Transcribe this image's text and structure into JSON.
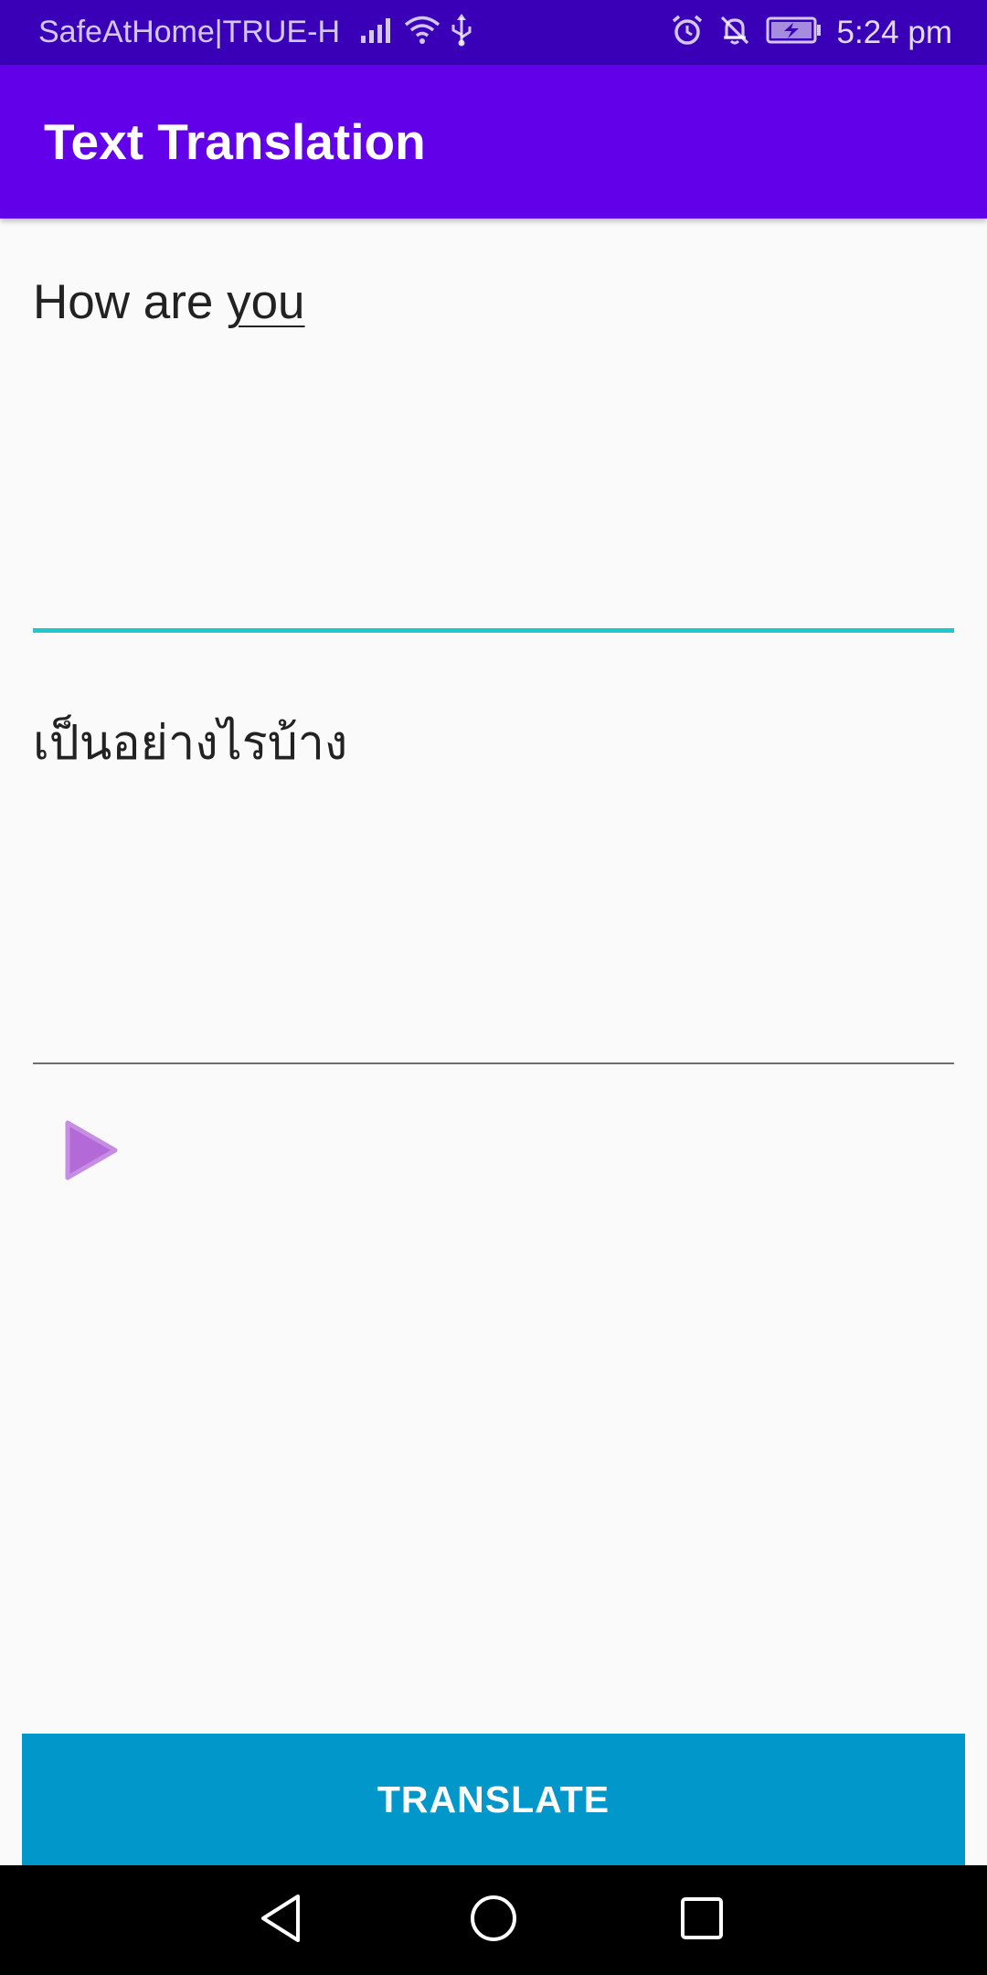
{
  "status_bar": {
    "carrier": "SafeAtHome|TRUE-H",
    "time": "5:24 pm",
    "icons": [
      "signal-icon",
      "wifi-icon",
      "usb-icon",
      "alarm-icon",
      "notifications-off-icon",
      "battery-charging-icon"
    ]
  },
  "app_bar": {
    "title": "Text Translation"
  },
  "source_input": {
    "value_plain": "How are ",
    "value_underlined": "you"
  },
  "result_output": {
    "value": "เป็นอย่างไรบ้าง"
  },
  "play_button": {
    "icon": "play-icon"
  },
  "translate_button": {
    "label": "TRANSLATE"
  },
  "nav_bar": {
    "icons": [
      "back-icon",
      "home-icon",
      "recents-icon"
    ]
  },
  "colors": {
    "status_bar": "#3a00b8",
    "app_bar": "#6200ea",
    "focused_underline": "#1fc8cc",
    "translate_button": "#0297cb",
    "play_icon": "#b36ad8"
  }
}
